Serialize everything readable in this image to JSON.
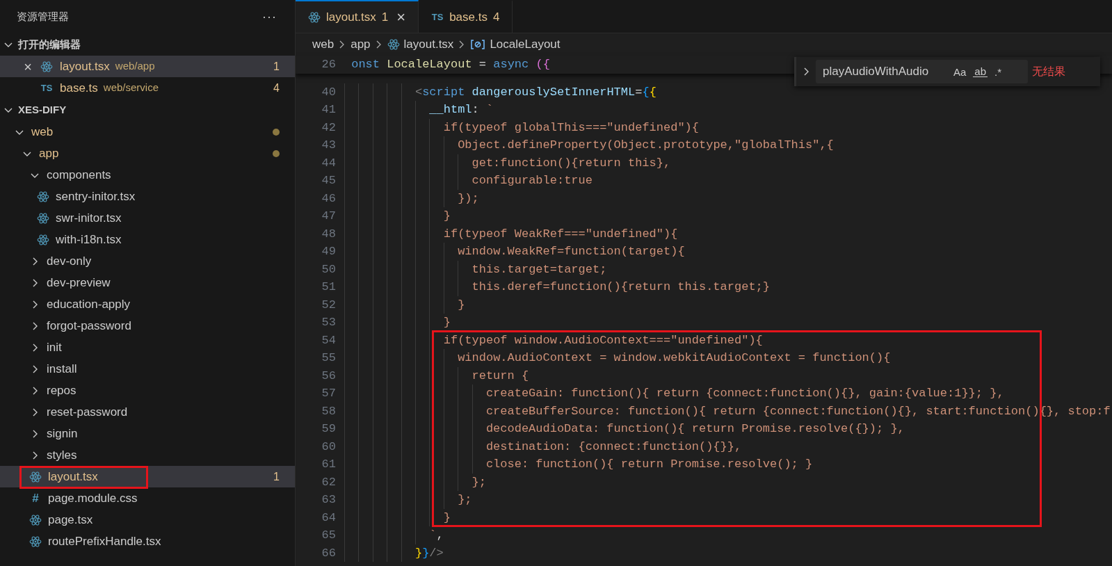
{
  "sidebar": {
    "title": "资源管理器",
    "more_button": "···",
    "sections": [
      {
        "title": "打开的编辑器",
        "kind": "open_editors",
        "expanded": true,
        "items": [
          {
            "name": "layout.tsx",
            "path": "web/app",
            "kind": "react",
            "problems": "1",
            "close": "×",
            "selected": true
          },
          {
            "name": "base.ts",
            "path": "web/service",
            "kind": "ts",
            "icon_text": "TS",
            "problems": "4",
            "selected": false
          }
        ]
      },
      {
        "title": "XES-DIFY",
        "kind": "tree",
        "expanded": true,
        "items": [
          {
            "name": "web",
            "kind": "folder",
            "expanded": true,
            "modified": true,
            "selected": false,
            "outlined": false,
            "children": [
              {
                "name": "app",
                "kind": "folder",
                "expanded": true,
                "modified": true,
                "selected": false,
                "outlined": false,
                "children": [
                  {
                    "name": "components",
                    "kind": "folder",
                    "expanded": true,
                    "modified": false,
                    "selected": false,
                    "outlined": false,
                    "children": [
                      {
                        "name": "sentry-initor.tsx",
                        "kind": "react",
                        "selected": false,
                        "outlined": false
                      },
                      {
                        "name": "swr-initor.tsx",
                        "kind": "react",
                        "selected": false,
                        "outlined": false
                      },
                      {
                        "name": "with-i18n.tsx",
                        "kind": "react",
                        "selected": false,
                        "outlined": false
                      }
                    ]
                  },
                  {
                    "name": "dev-only",
                    "kind": "folder",
                    "expanded": false,
                    "modified": false,
                    "selected": false,
                    "outlined": false
                  },
                  {
                    "name": "dev-preview",
                    "kind": "folder",
                    "expanded": false,
                    "modified": false,
                    "selected": false,
                    "outlined": false
                  },
                  {
                    "name": "education-apply",
                    "kind": "folder",
                    "expanded": false,
                    "modified": false,
                    "selected": false,
                    "outlined": false
                  },
                  {
                    "name": "forgot-password",
                    "kind": "folder",
                    "expanded": false,
                    "modified": false,
                    "selected": false,
                    "outlined": false
                  },
                  {
                    "name": "init",
                    "kind": "folder",
                    "expanded": false,
                    "modified": false,
                    "selected": false,
                    "outlined": false
                  },
                  {
                    "name": "install",
                    "kind": "folder",
                    "expanded": false,
                    "modified": false,
                    "selected": false,
                    "outlined": false
                  },
                  {
                    "name": "repos",
                    "kind": "folder",
                    "expanded": false,
                    "modified": false,
                    "selected": false,
                    "outlined": false
                  },
                  {
                    "name": "reset-password",
                    "kind": "folder",
                    "expanded": false,
                    "modified": false,
                    "selected": false,
                    "outlined": false
                  },
                  {
                    "name": "signin",
                    "kind": "folder",
                    "expanded": false,
                    "modified": false,
                    "selected": false,
                    "outlined": false
                  },
                  {
                    "name": "styles",
                    "kind": "folder",
                    "expanded": false,
                    "modified": false,
                    "selected": false,
                    "outlined": false
                  },
                  {
                    "name": "layout.tsx",
                    "kind": "react",
                    "problems": "1",
                    "selected": true,
                    "outlined": true
                  },
                  {
                    "name": "page.module.css",
                    "kind": "css",
                    "icon_text": "#",
                    "selected": false,
                    "outlined": false
                  },
                  {
                    "name": "page.tsx",
                    "kind": "react",
                    "selected": false,
                    "outlined": false
                  },
                  {
                    "name": "routePrefixHandle.tsx",
                    "kind": "react",
                    "selected": false,
                    "outlined": false
                  }
                ]
              }
            ]
          }
        ]
      }
    ]
  },
  "tabs": [
    {
      "label": "layout.tsx",
      "kind": "react",
      "problems": "1",
      "close": "×",
      "selected": true
    },
    {
      "label": "base.ts",
      "kind": "ts",
      "icon_text": "TS",
      "problems": "4",
      "selected": false
    }
  ],
  "breadcrumb": [
    {
      "text": "web",
      "kind": "folder"
    },
    {
      "text": "app",
      "kind": "folder"
    },
    {
      "text": "layout.tsx",
      "kind": "file"
    },
    {
      "text": "LocaleLayout",
      "kind": "symbol"
    }
  ],
  "find_widget": {
    "value": "playAudioWithAudio",
    "options": [
      {
        "label": "Aa",
        "kind": "case"
      },
      {
        "label": "ab",
        "kind": "word"
      },
      {
        "label": ".*",
        "kind": "regex"
      }
    ],
    "result": "无结果"
  },
  "code": {
    "sticky": {
      "number": "26",
      "tokens": [
        {
          "text": " onst",
          "kind": "keyword"
        },
        {
          "text": " LocaleLayout",
          "kind": "function"
        },
        {
          "text": " = ",
          "kind": "punct"
        },
        {
          "text": "async",
          "kind": "keyword"
        },
        {
          "text": " ({",
          "kind": "brace2"
        }
      ]
    },
    "blocks": [
      {
        "boxed": false,
        "lines": [
          {
            "number": "40",
            "tokens": [
              {
                "text": "          <",
                "kind": "tag"
              },
              {
                "text": "script",
                "kind": "keyword"
              },
              {
                "text": " dangerouslySetInnerHTML",
                "kind": "variable"
              },
              {
                "text": "=",
                "kind": "punct"
              },
              {
                "text": "{",
                "kind": "brace3"
              },
              {
                "text": "{",
                "kind": "brace1"
              }
            ]
          },
          {
            "number": "41",
            "tokens": [
              {
                "text": "            __html",
                "kind": "variable"
              },
              {
                "text": ": ",
                "kind": "punct"
              },
              {
                "text": "`",
                "kind": "string"
              }
            ]
          },
          {
            "number": "42",
            "tokens": [
              {
                "text": "              if(typeof globalThis===\"undefined\"){",
                "kind": "string"
              }
            ]
          },
          {
            "number": "43",
            "tokens": [
              {
                "text": "                Object.defineProperty(Object.prototype,\"globalThis\",{",
                "kind": "string"
              }
            ]
          },
          {
            "number": "44",
            "tokens": [
              {
                "text": "                  get:function(){return this},",
                "kind": "string"
              }
            ]
          },
          {
            "number": "45",
            "tokens": [
              {
                "text": "                  configurable:true",
                "kind": "string"
              }
            ]
          },
          {
            "number": "46",
            "tokens": [
              {
                "text": "                });",
                "kind": "string"
              }
            ]
          },
          {
            "number": "47",
            "tokens": [
              {
                "text": "              }",
                "kind": "string"
              }
            ]
          },
          {
            "number": "48",
            "tokens": [
              {
                "text": "              if(typeof WeakRef===\"undefined\"){",
                "kind": "string"
              }
            ]
          },
          {
            "number": "49",
            "tokens": [
              {
                "text": "                window.WeakRef=function(target){",
                "kind": "string"
              }
            ]
          },
          {
            "number": "50",
            "tokens": [
              {
                "text": "                  this.target=target;",
                "kind": "string"
              }
            ]
          },
          {
            "number": "51",
            "tokens": [
              {
                "text": "                  this.deref=function(){return this.target;}",
                "kind": "string"
              }
            ]
          },
          {
            "number": "52",
            "tokens": [
              {
                "text": "                }",
                "kind": "string"
              }
            ]
          },
          {
            "number": "53",
            "tokens": [
              {
                "text": "              }",
                "kind": "string"
              }
            ]
          }
        ]
      },
      {
        "boxed": true,
        "lines": [
          {
            "number": "54",
            "tokens": [
              {
                "text": "              if(typeof window.AudioContext===\"undefined\"){",
                "kind": "string"
              }
            ]
          },
          {
            "number": "55",
            "tokens": [
              {
                "text": "                window.AudioContext = window.webkitAudioContext = function(){",
                "kind": "string"
              }
            ]
          },
          {
            "number": "56",
            "tokens": [
              {
                "text": "                  return {",
                "kind": "string"
              }
            ]
          },
          {
            "number": "57",
            "tokens": [
              {
                "text": "                    createGain: function(){ return {connect:function(){}, gain:{value:1}}; },",
                "kind": "string"
              }
            ]
          },
          {
            "number": "58",
            "tokens": [
              {
                "text": "                    createBufferSource: function(){ return {connect:function(){}, start:function(){}, stop:f",
                "kind": "string"
              }
            ]
          },
          {
            "number": "59",
            "tokens": [
              {
                "text": "                    decodeAudioData: function(){ return Promise.resolve({}); },",
                "kind": "string"
              }
            ]
          },
          {
            "number": "60",
            "tokens": [
              {
                "text": "                    destination: {connect:function(){}},",
                "kind": "string"
              }
            ]
          },
          {
            "number": "61",
            "tokens": [
              {
                "text": "                    close: function(){ return Promise.resolve(); }",
                "kind": "string"
              }
            ]
          },
          {
            "number": "62",
            "tokens": [
              {
                "text": "                  };",
                "kind": "string"
              }
            ]
          },
          {
            "number": "63",
            "tokens": [
              {
                "text": "                };",
                "kind": "string"
              }
            ]
          },
          {
            "number": "64",
            "tokens": [
              {
                "text": "              }",
                "kind": "string"
              }
            ]
          }
        ]
      },
      {
        "boxed": false,
        "lines": [
          {
            "number": "65",
            "tokens": [
              {
                "text": "            `",
                "kind": "string"
              },
              {
                "text": ",",
                "kind": "punct"
              }
            ]
          },
          {
            "number": "66",
            "tokens": [
              {
                "text": "          }",
                "kind": "brace1"
              },
              {
                "text": "}",
                "kind": "brace3"
              },
              {
                "text": "/>",
                "kind": "tag"
              }
            ]
          }
        ]
      }
    ]
  }
}
